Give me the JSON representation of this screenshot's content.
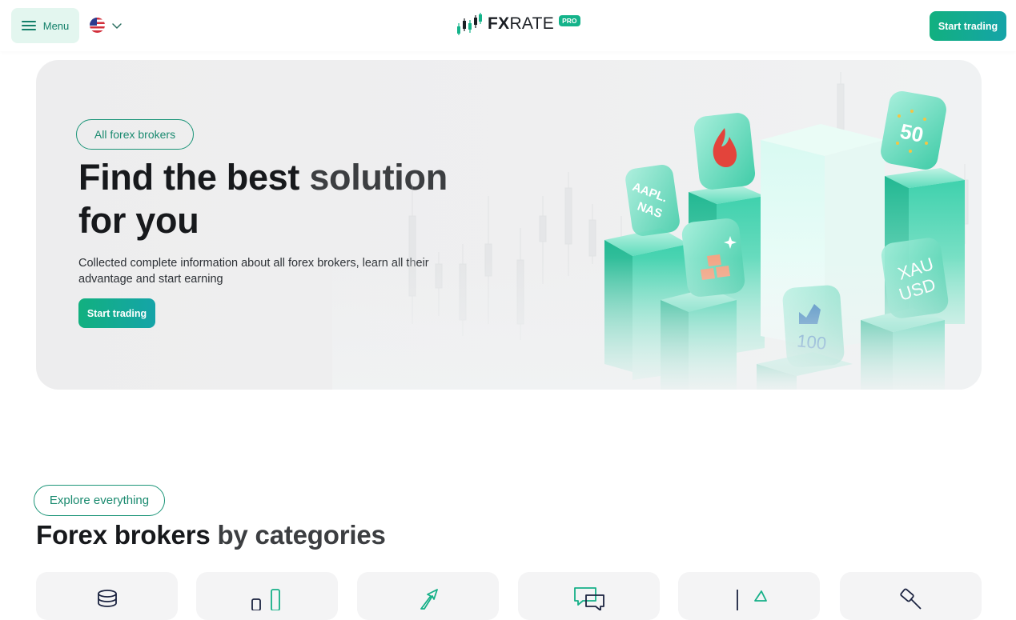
{
  "header": {
    "menu_label": "Menu",
    "language_flag": "us-flag-icon",
    "logo_main_bold": "FX",
    "logo_main_rest": "RATE",
    "logo_badge": "PRO",
    "start_label": "Start trading"
  },
  "hero": {
    "pill_label": "All forex brokers",
    "title_part1": "Find the best ",
    "title_part2": "solution",
    "title_part3": "for you",
    "description": "Collected complete information about all forex brokers, learn all their advantage and start earning",
    "cta_label": "Start trading",
    "art_tiles": [
      "AAPL. NAS",
      "50",
      "XAU USD",
      "100"
    ]
  },
  "categories": {
    "pill_label": "Explore everything",
    "title_part1": "Forex brokers ",
    "title_part2": "by categories",
    "icons": [
      "coins-icon",
      "bar-chart-icon",
      "arrow-up-icon",
      "chat-icon",
      "growth-icon",
      "gavel-icon"
    ]
  },
  "colors": {
    "accent": "#14b38a",
    "accent_dark": "#1a8a6f",
    "hero_bg": "#efeff0",
    "text": "#17191c"
  }
}
